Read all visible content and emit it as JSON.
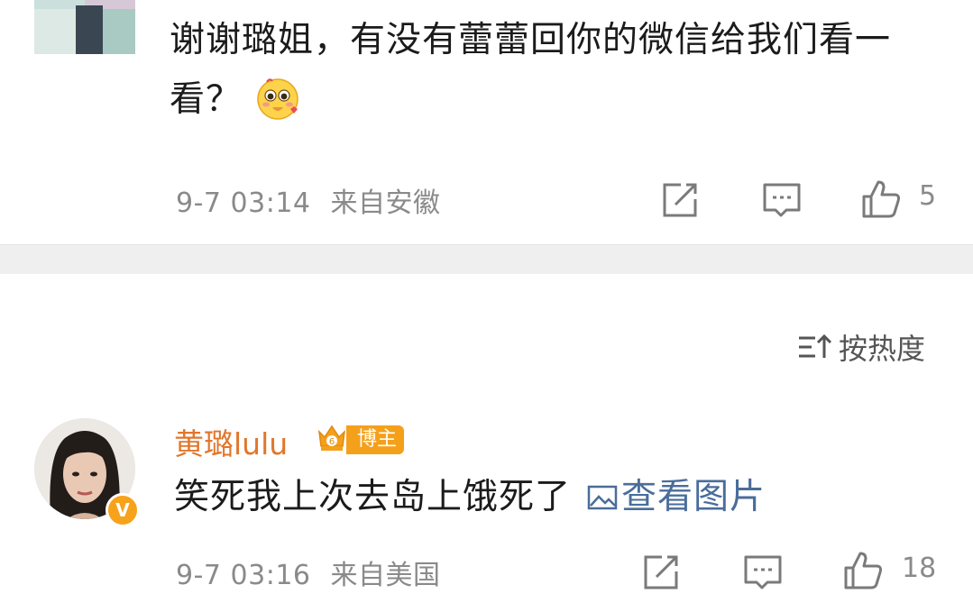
{
  "comment1": {
    "text": "谢谢璐姐，有没有蕾蕾回你的微信给我们看一看？",
    "time": "9-7 03:14",
    "location": "来自安徽",
    "likes": "5",
    "emoji_icon": "blush-emoji-icon"
  },
  "sort": {
    "label": "按热度"
  },
  "comment2": {
    "username": "黄璐lulu",
    "tag": "博主",
    "text": "笑死我上次去岛上饿死了",
    "link": "查看图片",
    "time": "9-7 03:16",
    "location": "来自美国",
    "likes": "18",
    "verified_badge": "V"
  },
  "colors": {
    "username": "#e2762b",
    "tag_bg": "#f5a01a",
    "link": "#4a6d9a",
    "meta": "#8a8a8a"
  }
}
